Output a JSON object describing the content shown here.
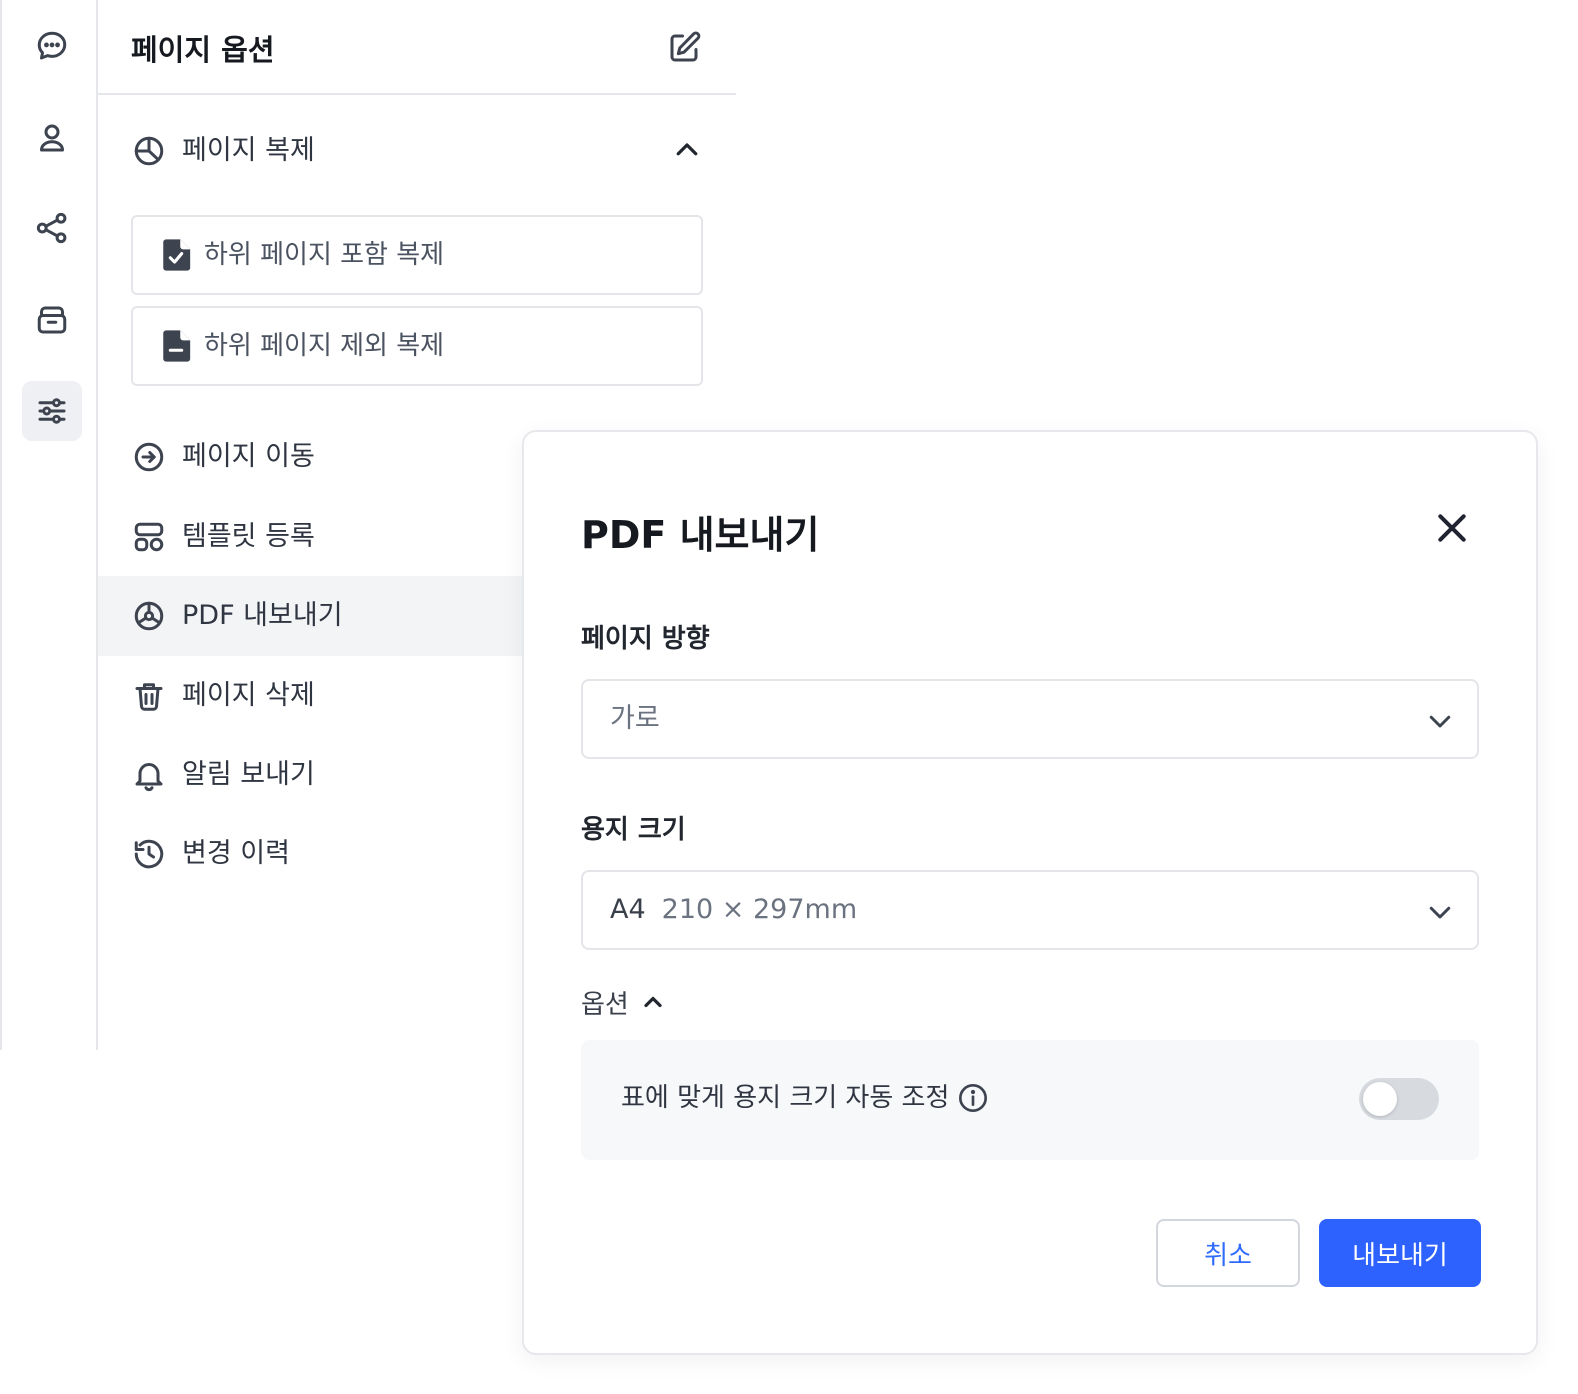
{
  "panel": {
    "title": "페이지 옵션",
    "duplicate": {
      "label": "페이지 복제",
      "sub_options": [
        {
          "label": "하위 페이지 포함 복제"
        },
        {
          "label": "하위 페이지 제외 복제"
        }
      ]
    },
    "menu": [
      {
        "label": "페이지 이동",
        "icon": "move-page-icon"
      },
      {
        "label": "템플릿 등록",
        "icon": "template-icon"
      },
      {
        "label": "PDF 내보내기",
        "icon": "pdf-icon"
      },
      {
        "label": "페이지 삭제",
        "icon": "trash-icon"
      },
      {
        "label": "알림 보내기",
        "icon": "bell-icon"
      },
      {
        "label": "변경 이력",
        "icon": "history-icon"
      }
    ],
    "active_item": "PDF 내보내기"
  },
  "rail": {
    "items": [
      "chat-icon",
      "user-icon",
      "share-icon",
      "archive-icon",
      "sliders-icon"
    ],
    "active": "sliders-icon"
  },
  "modal": {
    "title": "PDF 내보내기",
    "orientation": {
      "label": "페이지 방향",
      "value": "가로"
    },
    "paper_size": {
      "label": "용지 크기",
      "value_name": "A4",
      "value_dims": "210 × 297mm"
    },
    "options": {
      "label": "옵션",
      "expanded": true,
      "auto_fit": {
        "label": "표에 맞게 용지 크기 자동 조정",
        "enabled": false
      }
    },
    "cancel_label": "취소",
    "export_label": "내보내기"
  },
  "colors": {
    "primary": "#2e62ff",
    "icon": "#3d4450",
    "active_bg": "#f3f4f6"
  }
}
